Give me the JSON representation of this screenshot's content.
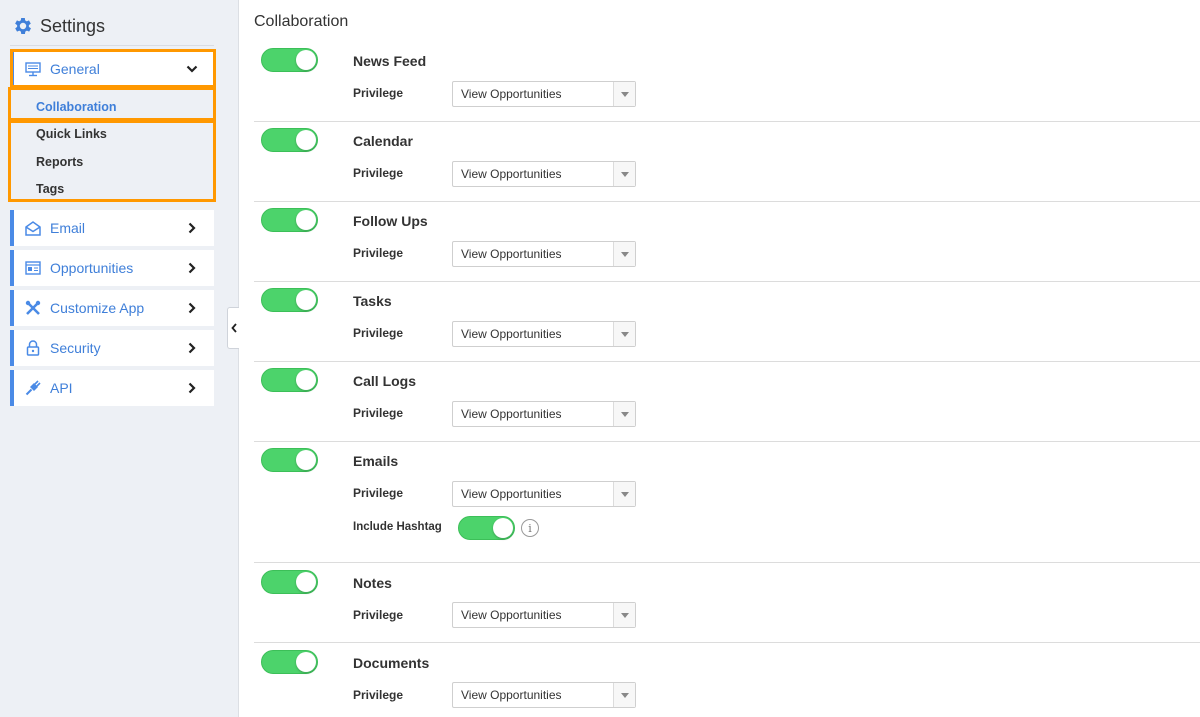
{
  "sidebar": {
    "title": "Settings",
    "general": {
      "label": "General"
    },
    "general_sub": [
      "Collaboration",
      "Quick Links",
      "Reports",
      "Tags"
    ],
    "items": [
      {
        "label": "Email",
        "icon": "envelope-open-icon"
      },
      {
        "label": "Opportunities",
        "icon": "id-card-icon"
      },
      {
        "label": "Customize App",
        "icon": "tools-icon"
      },
      {
        "label": "Security",
        "icon": "lock-icon"
      },
      {
        "label": "API",
        "icon": "plug-icon"
      }
    ],
    "accent_color": "#4a8ae6",
    "highlight_color": "#ff9800"
  },
  "main": {
    "title": "Collaboration",
    "privilege_label": "Privilege",
    "hashtag_label": "Include Hashtag",
    "sections": [
      {
        "name": "News Feed",
        "privilege": "View Opportunities",
        "enabled": true
      },
      {
        "name": "Calendar",
        "privilege": "View Opportunities",
        "enabled": true
      },
      {
        "name": "Follow Ups",
        "privilege": "View Opportunities",
        "enabled": true
      },
      {
        "name": "Tasks",
        "privilege": "View Opportunities",
        "enabled": true
      },
      {
        "name": "Call Logs",
        "privilege": "View Opportunities",
        "enabled": true
      },
      {
        "name": "Emails",
        "privilege": "View Opportunities",
        "enabled": true,
        "include_hashtag": true
      },
      {
        "name": "Notes",
        "privilege": "View Opportunities",
        "enabled": true
      },
      {
        "name": "Documents",
        "privilege": "View Opportunities",
        "enabled": true
      }
    ],
    "toggle_on_color": "#4cd36b"
  }
}
